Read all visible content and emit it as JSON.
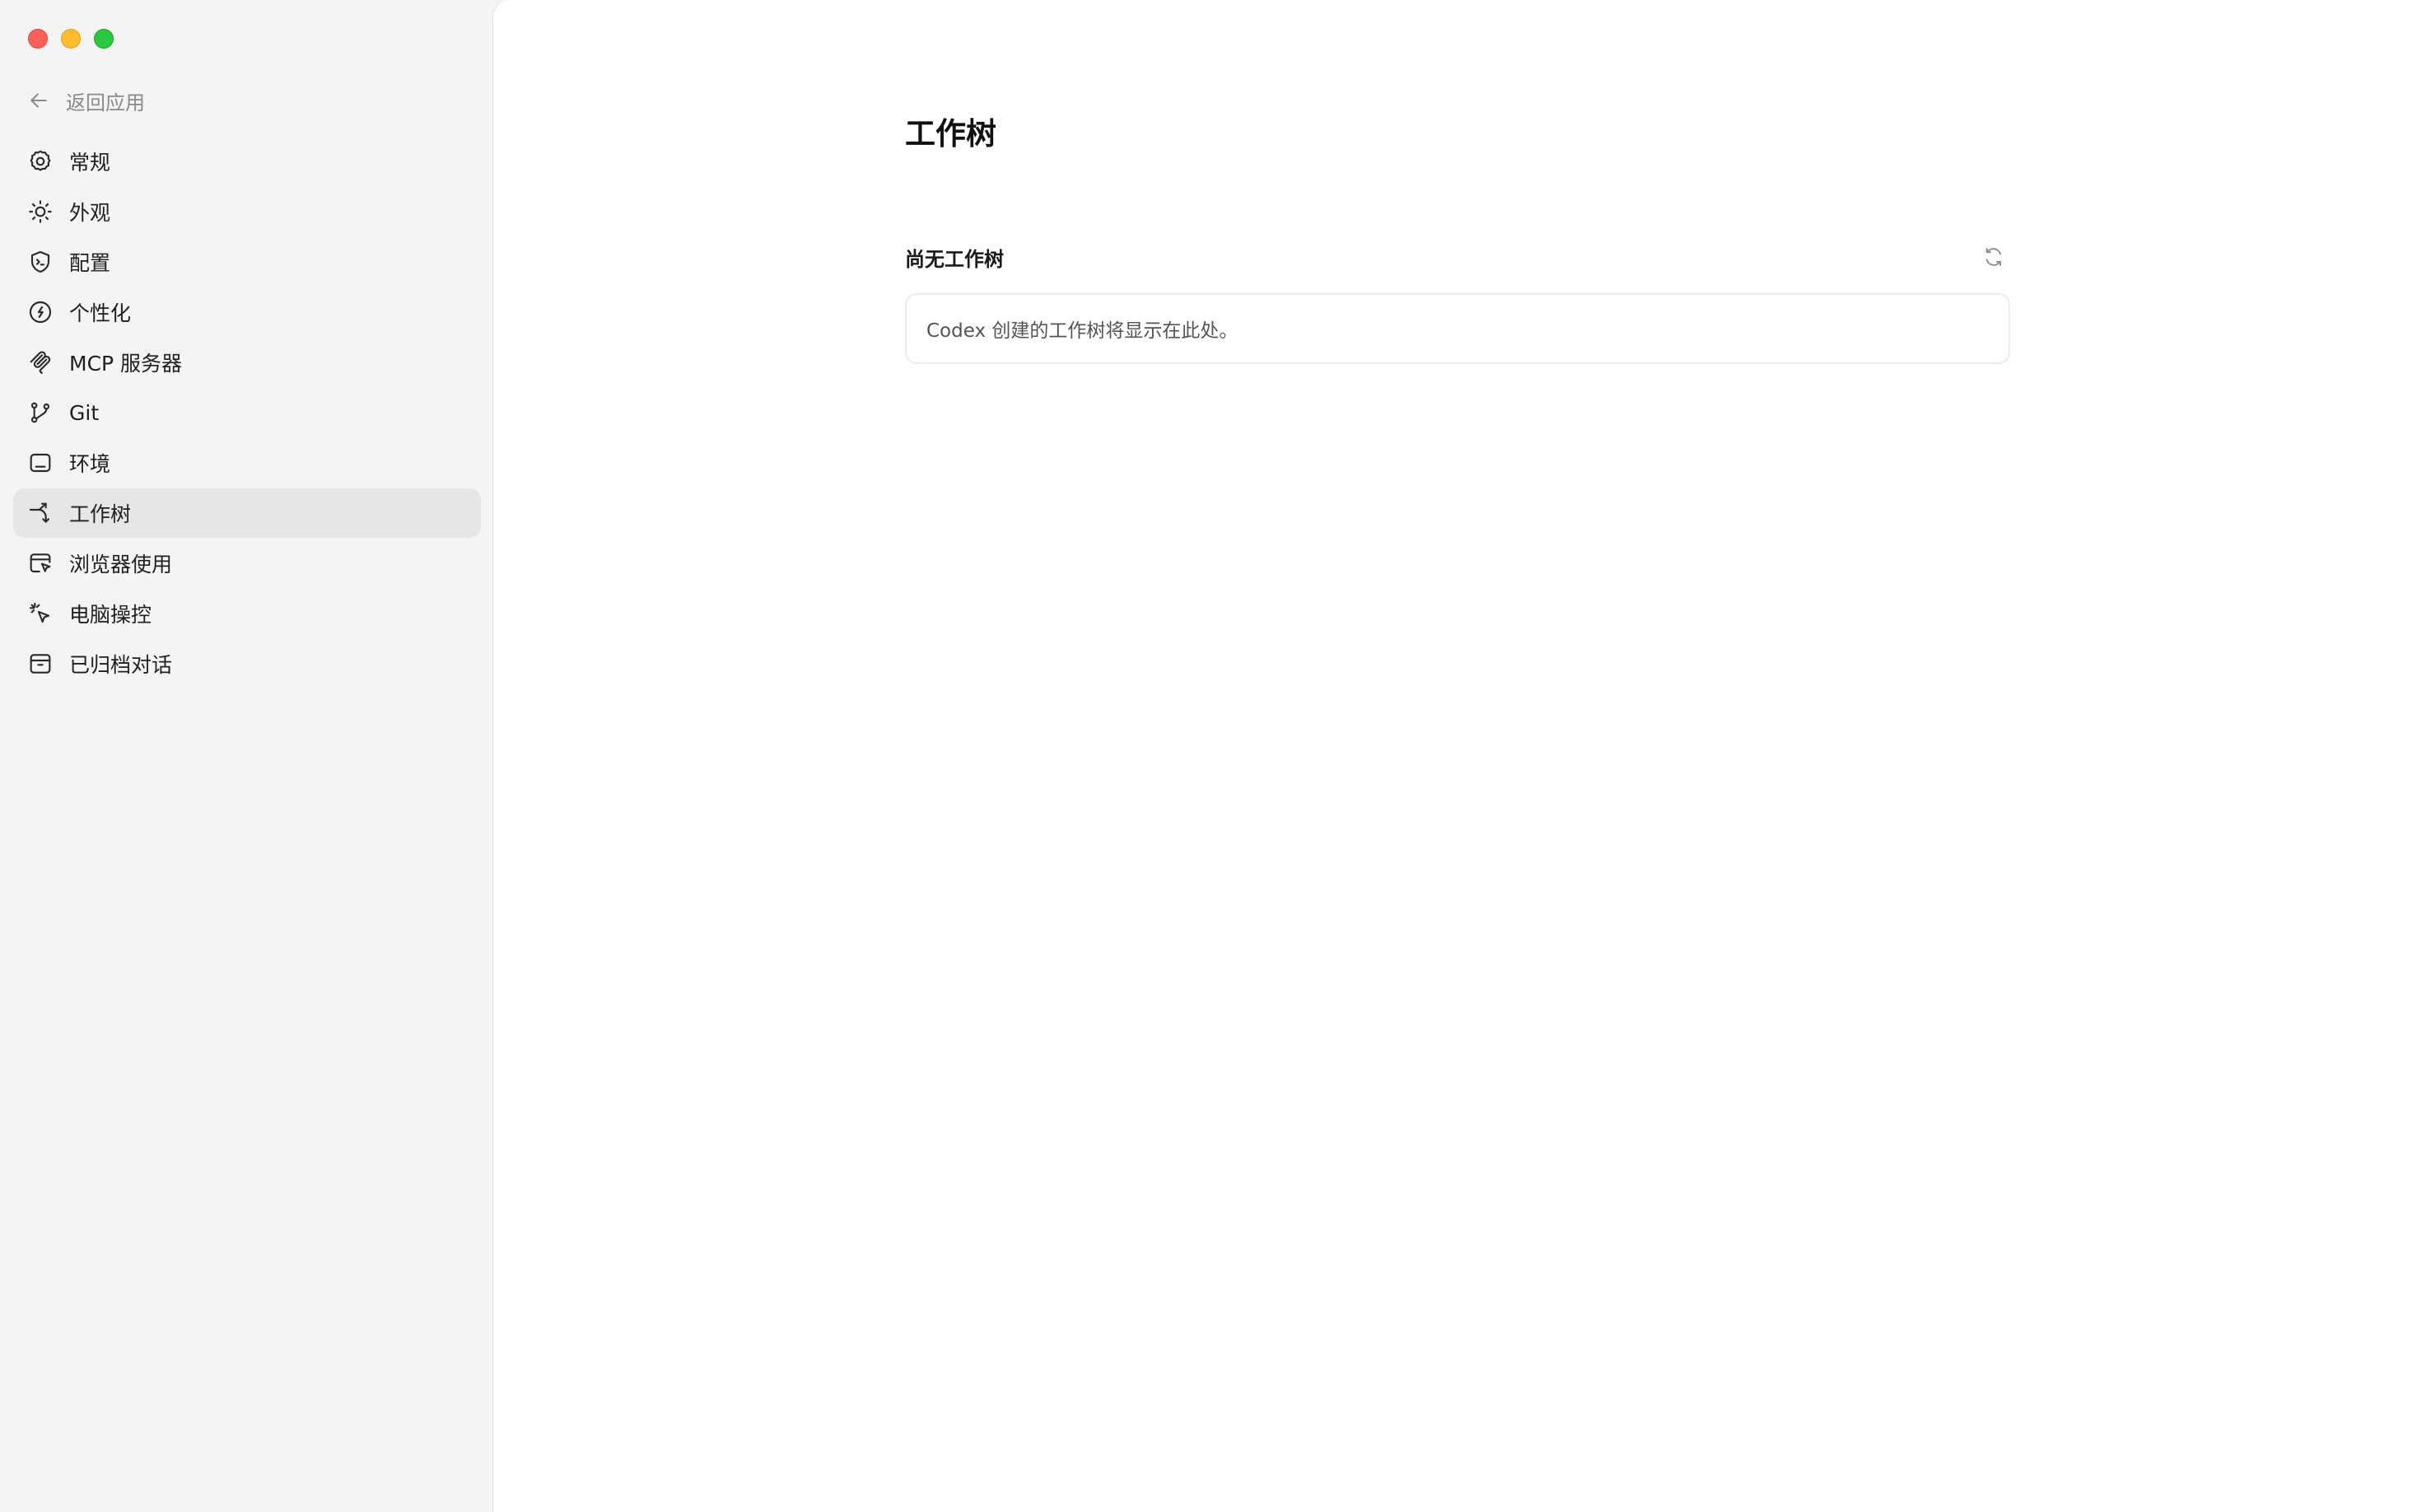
{
  "window": {
    "controls": [
      "close",
      "minimize",
      "maximize"
    ]
  },
  "sidebar": {
    "back_label": "返回应用",
    "items": [
      {
        "label": "常规",
        "icon": "gear-icon"
      },
      {
        "label": "外观",
        "icon": "sun-icon"
      },
      {
        "label": "配置",
        "icon": "shield-terminal-icon"
      },
      {
        "label": "个性化",
        "icon": "face-icon"
      },
      {
        "label": "MCP 服务器",
        "icon": "mcp-icon"
      },
      {
        "label": "Git",
        "icon": "git-branch-icon"
      },
      {
        "label": "环境",
        "icon": "environment-icon"
      },
      {
        "label": "工作树",
        "icon": "worktree-icon",
        "active": true
      },
      {
        "label": "浏览器使用",
        "icon": "browser-cursor-icon"
      },
      {
        "label": "电脑操控",
        "icon": "computer-cursor-icon"
      },
      {
        "label": "已归档对话",
        "icon": "archive-icon"
      }
    ]
  },
  "main": {
    "title": "工作树",
    "section": {
      "title": "尚无工作树",
      "refresh_icon": "refresh-icon",
      "empty_message": "Codex 创建的工作树将显示在此处。"
    }
  },
  "colors": {
    "sidebar_bg": "#f4f4f4",
    "active_item_bg": "#e6e6e6",
    "main_bg": "#ffffff",
    "close": "#fe5f57",
    "minimize": "#febc2e",
    "maximize": "#28c840"
  }
}
